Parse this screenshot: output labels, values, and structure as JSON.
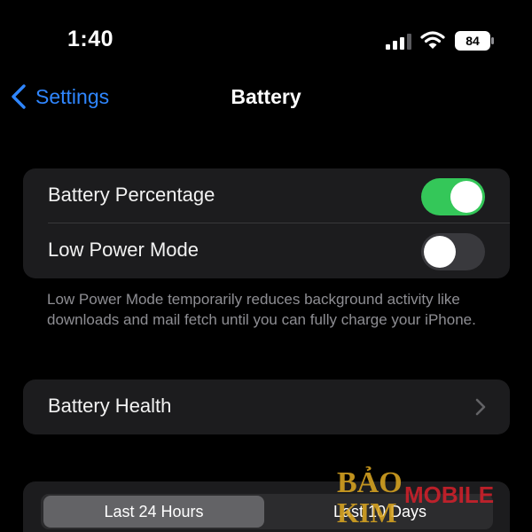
{
  "status_bar": {
    "time": "1:40",
    "battery_level": "84",
    "icons": [
      "signal-icon",
      "wifi-icon",
      "battery-icon"
    ]
  },
  "nav": {
    "back_label": "Settings",
    "title": "Battery"
  },
  "toggles": [
    {
      "label": "Battery Percentage",
      "state": "on"
    },
    {
      "label": "Low Power Mode",
      "state": "off"
    }
  ],
  "footnote": "Low Power Mode temporarily reduces background activity like downloads and mail fetch until you can fully charge your iPhone.",
  "health": {
    "label": "Battery Health"
  },
  "segments": {
    "items": [
      "Last 24 Hours",
      "Last 10 Days"
    ],
    "selected": "Last 24 Hours"
  },
  "watermark": {
    "line1": "BẢO",
    "line2": "KIM",
    "line3": "MOBILE"
  },
  "colors": {
    "accent": "#2f86ff",
    "toggle_on": "#34c759",
    "toggle_off": "#39393d",
    "group_background": "#1c1c1e",
    "watermark_gold": "#d9a521",
    "watermark_red": "#d6202a"
  }
}
